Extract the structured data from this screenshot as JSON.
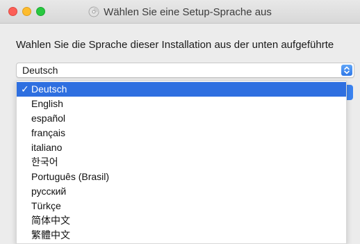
{
  "window": {
    "title": "Wählen Sie eine Setup-Sprache aus"
  },
  "instruction": "Wahlen Sie die Sprache dieser Installation aus der unten aufgeführte",
  "language_select": {
    "selected_value": "Deutsch",
    "check_mark": "✓",
    "options": [
      {
        "label": "Deutsch",
        "selected": true
      },
      {
        "label": "English",
        "selected": false
      },
      {
        "label": "español",
        "selected": false
      },
      {
        "label": "français",
        "selected": false
      },
      {
        "label": "italiano",
        "selected": false
      },
      {
        "label": "한국어",
        "selected": false
      },
      {
        "label": "Português (Brasil)",
        "selected": false
      },
      {
        "label": "русский",
        "selected": false
      },
      {
        "label": "Türkçe",
        "selected": false
      },
      {
        "label": "简体中文",
        "selected": false
      },
      {
        "label": "繁體中文",
        "selected": false
      }
    ]
  },
  "icons": {
    "window_close": "close-light-icon",
    "window_minimize": "minimize-light-icon",
    "window_maximize": "zoom-light-icon",
    "app": "installer-disc-icon",
    "popup": "up-down-chevrons-icon"
  },
  "colors": {
    "accent": "#2e6fe0",
    "close": "#fc5f57",
    "minimize": "#fdbc2e",
    "maximize": "#28c840"
  }
}
